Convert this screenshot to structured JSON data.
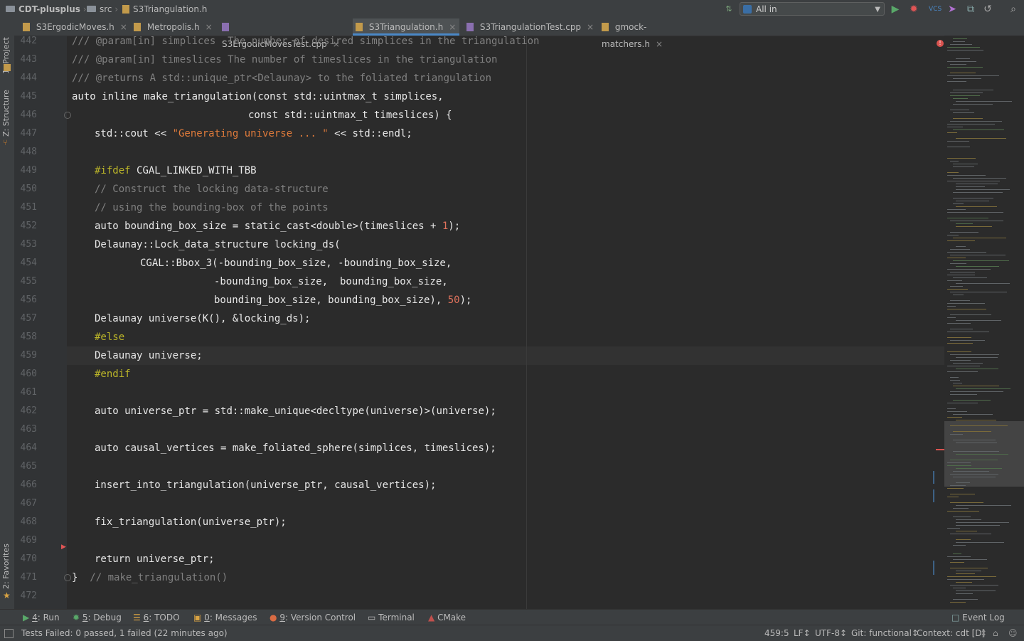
{
  "breadcrumb": {
    "project": "CDT-plusplus",
    "folder": "src",
    "file": "S3Triangulation.h"
  },
  "run_config": "All in S3ErgodicMovesTest.cpp",
  "tabs": [
    {
      "label": "S3ErgodicMoves.h",
      "type": "h",
      "active": false
    },
    {
      "label": "Metropolis.h",
      "type": "h",
      "active": false
    },
    {
      "label": "S3ErgodicMovesTest.cpp",
      "type": "cpp",
      "active": false
    },
    {
      "label": "S3Triangulation.h",
      "type": "h",
      "active": true
    },
    {
      "label": "S3TriangulationTest.cpp",
      "type": "cpp",
      "active": false
    },
    {
      "label": "gmock-matchers.h",
      "type": "h",
      "active": false
    }
  ],
  "left_tools": [
    "1: Project",
    "Z: Structure",
    "2: Favorites"
  ],
  "line_numbers": [
    "442",
    "443",
    "444",
    "445",
    "446",
    "447",
    "448",
    "449",
    "450",
    "451",
    "452",
    "453",
    "454",
    "455",
    "456",
    "457",
    "458",
    "459",
    "460",
    "461",
    "462",
    "463",
    "464",
    "465",
    "466",
    "467",
    "468",
    "469",
    "470",
    "471",
    "472"
  ],
  "code": {
    "l442": "/// @param[in] simplices  The number of desired simplices in the triangulation",
    "l443": "/// @param[in] timeslices The number of timeslices in the triangulation",
    "l444": "/// @returns A std::unique_ptr<Delaunay> to the foliated triangulation",
    "l445_kw": "auto inline ",
    "l445_rest": "make_triangulation(",
    "l445_kw2": "const ",
    "l445_tail": "std::uintmax_t simplices,",
    "l446_kw": "const ",
    "l446_tail": "std::uintmax_t timeslices) {",
    "l447_a": "std::cout << ",
    "l447_str": "\"Generating universe ... \"",
    "l447_b": " << std::endl;",
    "l449_pre": "#ifdef ",
    "l449_b": "CGAL_LINKED_WITH_TBB",
    "l450": "// Construct the locking data-structure",
    "l451": "// using the bounding-box of the points",
    "l452_kw": "auto ",
    "l452_a": "bounding_box_size = ",
    "l452_kw2": "static_cast",
    "l452_b": "<double>(timeslices + ",
    "l452_num": "1",
    "l452_c": ");",
    "l453": "Delaunay::Lock_data_structure locking_ds(",
    "l454": "CGAL::Bbox_3(-bounding_box_size, -bounding_box_size,",
    "l455": "-bounding_box_size,  bounding_box_size,",
    "l456_a": "bounding_box_size, bounding_box_size), ",
    "l456_num": "50",
    "l456_b": ");",
    "l457": "Delaunay universe(K(), &locking_ds);",
    "l458": "#else",
    "l459": "Delaunay universe;",
    "l460": "#endif",
    "l462_kw": "auto ",
    "l462_a": "universe_ptr = std::make_unique<",
    "l462_kw2": "decltype",
    "l462_b": "(universe)>(universe);",
    "l464_kw": "auto ",
    "l464_a": "causal_vertices = make_foliated_sphere(simplices, timeslices);",
    "l466": "insert_into_triangulation(universe_ptr, causal_vertices);",
    "l468": "fix_triangulation(universe_ptr);",
    "l470_kw": "return ",
    "l470_a": "universe_ptr;",
    "l471_a": "}  ",
    "l471_cm": "// make_triangulation()"
  },
  "bottom_tools": [
    {
      "num": "4",
      "label": "Run"
    },
    {
      "num": "5",
      "label": "Debug"
    },
    {
      "num": "6",
      "label": "TODO"
    },
    {
      "num": "0",
      "label": "Messages"
    },
    {
      "num": "9",
      "label": "Version Control"
    },
    {
      "num": "",
      "label": "Terminal"
    },
    {
      "num": "",
      "label": "CMake"
    }
  ],
  "event_log": "Event Log",
  "status": {
    "message": "Tests Failed: 0 passed, 1 failed (22 minutes ago)",
    "position": "459:5",
    "line_sep": "LF↕",
    "encoding": "UTF-8↕",
    "git": "Git: functional↕",
    "context": "Context: cdt [D]"
  },
  "colors": {
    "accent": "#4a88c7",
    "keyword": "#cc7832",
    "string": "#6a8759",
    "number": "#6897bb",
    "preprocessor": "#bbb529",
    "comment": "#808080"
  }
}
